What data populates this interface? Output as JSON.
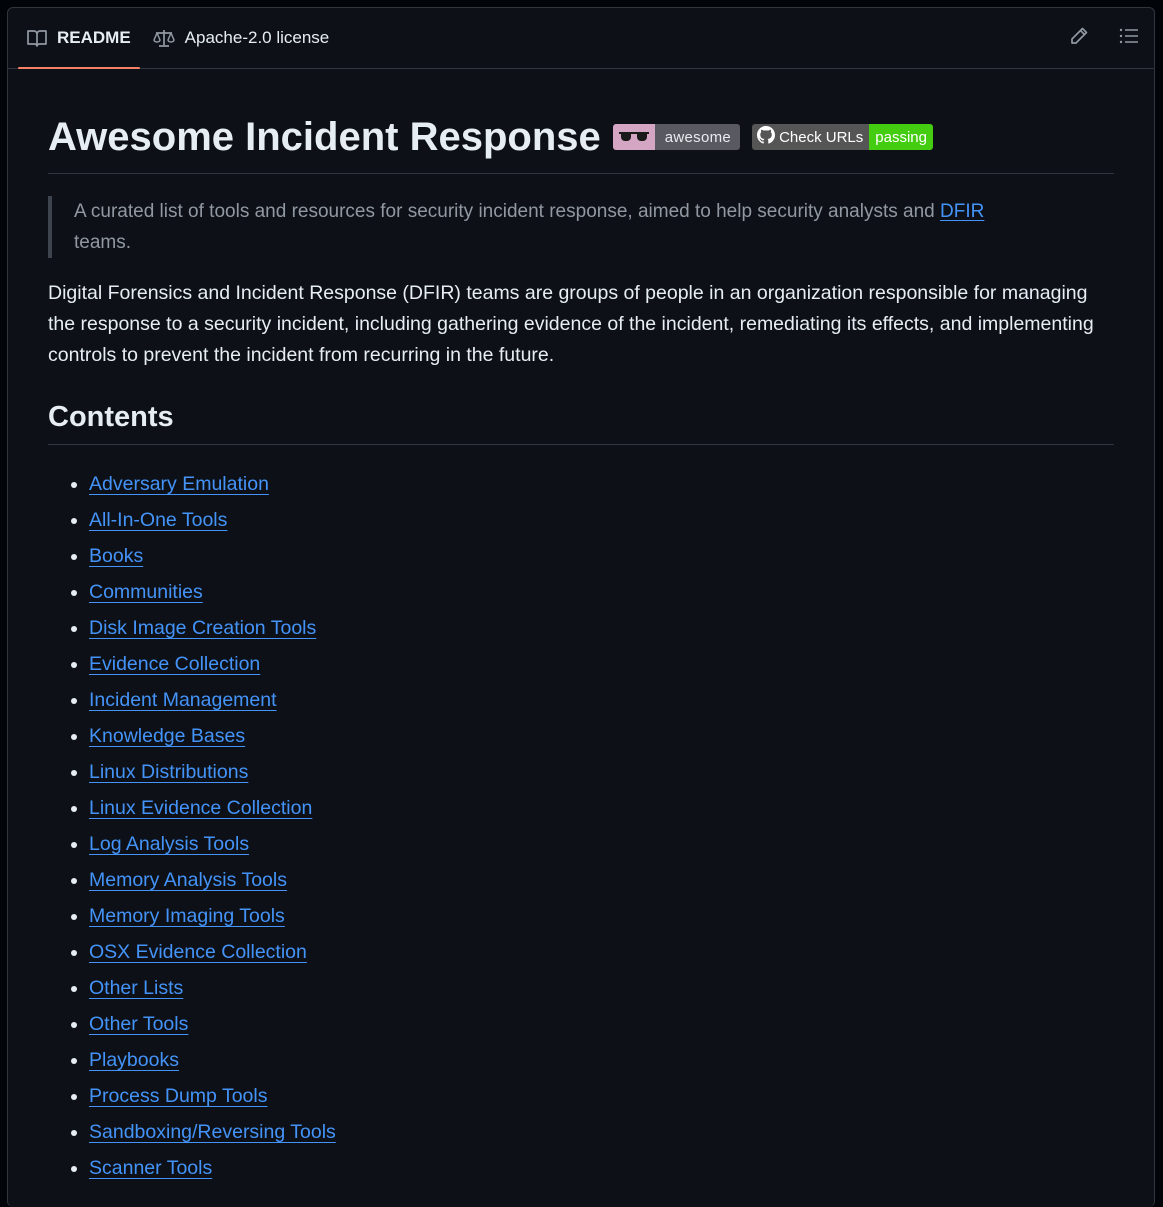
{
  "tabs": {
    "readme": "README",
    "license": "Apache-2.0 license"
  },
  "icons": {
    "readme": "book-icon",
    "license": "law-scale-icon",
    "edit": "pencil-icon",
    "outline": "list-unordered-icon"
  },
  "readme": {
    "title": "Awesome Incident Response",
    "badges": {
      "awesome_label": "awesome",
      "ci_label": "Check URLs",
      "ci_status": "passing"
    },
    "quote_text": "A curated list of tools and resources for security incident response, aimed to help security analysts and ",
    "quote_link": "DFIR",
    "quote_tail": " teams.",
    "intro": "Digital Forensics and Incident Response (DFIR) teams are groups of people in an organization responsible for managing the response to a security incident, including gathering evidence of the incident, remediating its effects, and implementing controls to prevent the incident from recurring in the future.",
    "contents_heading": "Contents",
    "contents": [
      "Adversary Emulation",
      "All-In-One Tools",
      "Books",
      "Communities",
      "Disk Image Creation Tools",
      "Evidence Collection",
      "Incident Management",
      "Knowledge Bases",
      "Linux Distributions",
      "Linux Evidence Collection",
      "Log Analysis Tools",
      "Memory Analysis Tools",
      "Memory Imaging Tools",
      "OSX Evidence Collection",
      "Other Lists",
      "Other Tools",
      "Playbooks",
      "Process Dump Tools",
      "Sandboxing/Reversing Tools",
      "Scanner Tools"
    ]
  },
  "colors": {
    "link": "#4493f8",
    "tab_underline": "#f78166",
    "badge_awesome_left": "#d5a6c4",
    "badge_passing": "#44cc11"
  }
}
